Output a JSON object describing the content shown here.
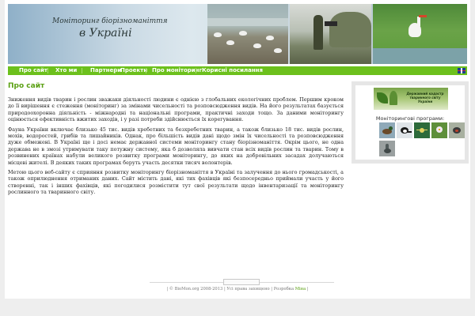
{
  "banner": {
    "title_line1": "Моніторинг біорізноманіття",
    "title_line2": "в Україні"
  },
  "nav": {
    "items": [
      {
        "label": "Про сайт"
      },
      {
        "label": "Хто ми"
      },
      {
        "label": "Партнери"
      },
      {
        "label": "Проекти"
      },
      {
        "label": "Про моніторинг"
      },
      {
        "label": "Корисні посилання"
      }
    ],
    "language_icon": "uk-flag-icon"
  },
  "main": {
    "title": "Про сайт",
    "paragraphs": [
      "Зниження видів тварин і рослин зважаки діяльності людини є однією з глобальних екологічних проблем. Першим кроком до її вирішення є стеження (моніторинг) за змінами чисельності та розповсюдження видів. На його результатах базується природоохоронна діяльність - міжнародні та національні програми, практичні заходи тощо. За даними моніторингу оцінюється ефективність вжитих заходів, і у разі потреби здійснюється їх корегування.",
      "Фауна України включає близько 45 тис. видів хребетних та безхребетних тварин, а також близько 18 тис. видів рослин, мохів, водоростей, грибів та лишайників. Однак, про більшість видів дані щодо змін їх чисельності та розповсюдження дуже обмежені. В Україні ще і досі немає державної системи моніторингу стану біорізноманіття. Окрім цього, не одна держава не в змозі утримувати таку потужну систему, яка б дозволяла вивчати стан всіх видів рослин та тварин. Тому в розвинених країнах набули великого розвитку програми моніторингу, до яких на добровільних засадах долучаються місцеві жителі. В деяких таких програмах беруть участь десятки тисяч волонтерів.",
      "Метою цього веб-сайту є сприяння розвитку моніторингу біорізноманіття в Україні та залучення до нього громадськості, а також оприлюднення отриманих даних. Сайт містить дані, які тих фахівців які безпосередньо приймали участь у його створенні, так і інших фахівців, які погодилися розмістити тут свої результати щодо інвентаризації та моніторингу рослинного та тваринного світу."
    ]
  },
  "sidebar": {
    "cadastre_text": "Державний кадастр тваринного світу України",
    "programs_label": "Моніторингові програми:",
    "programs": [
      {
        "icon": "duck-icon"
      },
      {
        "icon": "magpie-icon"
      },
      {
        "icon": "spider-icon"
      },
      {
        "icon": "flower-icon"
      },
      {
        "icon": "bird-icon"
      },
      {
        "icon": "heron-icon"
      }
    ]
  },
  "footer": {
    "search_placeholder": "",
    "copyright": "| © BioMon.org 2008-2013 | Усі права захищено | Розробка",
    "developer": "Міна",
    "trailing": " |"
  },
  "colors": {
    "nav_bg": "#6cc01c",
    "title_green": "#5aa012",
    "background": "#eeeeee"
  }
}
